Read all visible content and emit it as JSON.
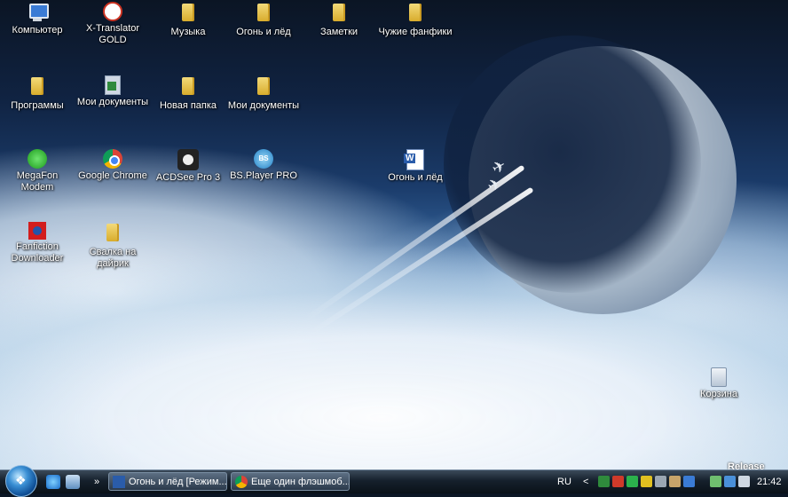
{
  "desktop": {
    "icons": [
      {
        "label": "Компьютер",
        "icon": "computer-icon"
      },
      {
        "label": "X-Translator\nGOLD",
        "icon": "x-translator-icon"
      },
      {
        "label": "Музыка",
        "icon": "folder-icon"
      },
      {
        "label": "Огонь и лёд",
        "icon": "folder-icon"
      },
      {
        "label": "Заметки",
        "icon": "folder-icon"
      },
      {
        "label": "Чужие фанфики",
        "icon": "folder-icon"
      },
      {
        "label": "Программы",
        "icon": "folder-icon"
      },
      {
        "label": "Мои документы",
        "icon": "my-documents-icon"
      },
      {
        "label": "Новая папка",
        "icon": "folder-icon"
      },
      {
        "label": "Мои документы",
        "icon": "folder-icon"
      },
      {
        "label": "MegaFon Modem",
        "icon": "megafon-modem-icon"
      },
      {
        "label": "Google Chrome",
        "icon": "chrome-icon"
      },
      {
        "label": "ACDSee Pro 3",
        "icon": "acdsee-icon"
      },
      {
        "label": "BS.Player PRO",
        "icon": "bsplayer-icon"
      },
      {
        "label": "Огонь и лёд",
        "icon": "word-document-icon"
      },
      {
        "label": "Fanfiction\nDownloader",
        "icon": "fanfiction-downloader-icon"
      },
      {
        "label": "Свалка на\nдайрик",
        "icon": "folder-icon"
      },
      {
        "label": "Корзина",
        "icon": "recycle-bin-icon"
      }
    ],
    "watermark": "Release"
  },
  "taskbar": {
    "start_label": "Start",
    "quick_launch": [
      "ie-icon",
      "show-desktop-icon"
    ],
    "overflow": "»",
    "buttons": [
      {
        "label": "Огонь и лёд [Режим...",
        "icon": "word-icon"
      },
      {
        "label": "Еще один флэшмоб...",
        "icon": "chrome-icon"
      }
    ],
    "tray": {
      "language": "RU",
      "chevron": "<",
      "time": "21:42"
    }
  }
}
